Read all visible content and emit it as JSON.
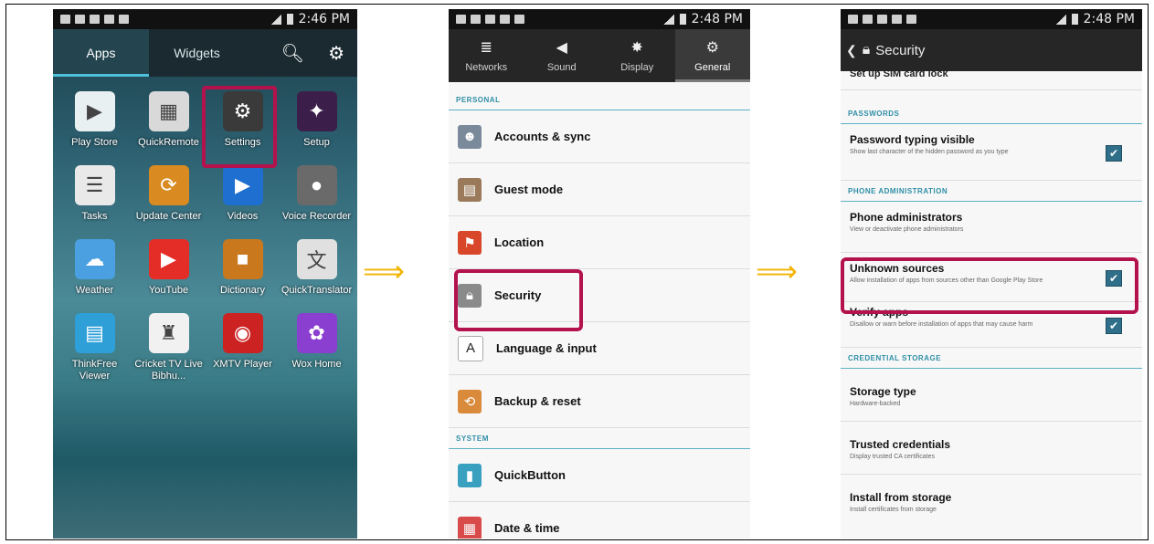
{
  "phone1": {
    "status_time": "2:46 PM",
    "tabs": [
      "Apps",
      "Widgets"
    ],
    "top_icons": [
      "search-icon",
      "gear-icon"
    ],
    "apps": [
      {
        "label": "Play Store",
        "icon": "play-store-icon",
        "color": "#e8f0f2"
      },
      {
        "label": "QuickRemote",
        "icon": "remote-icon",
        "color": "#d9d9d9"
      },
      {
        "label": "Settings",
        "icon": "gear-icon",
        "color": "#3a3a3a"
      },
      {
        "label": "Setup",
        "icon": "magic-hat-icon",
        "color": "#3b1f4a"
      },
      {
        "label": "Tasks",
        "icon": "tasks-icon",
        "color": "#e9e9e9"
      },
      {
        "label": "Update Center",
        "icon": "update-icon",
        "color": "#d98a20"
      },
      {
        "label": "Videos",
        "icon": "video-icon",
        "color": "#1e6fd0"
      },
      {
        "label": "Voice Recorder",
        "icon": "mic-icon",
        "color": "#6a6a6a"
      },
      {
        "label": "Weather",
        "icon": "weather-icon",
        "color": "#4aa0e0"
      },
      {
        "label": "YouTube",
        "icon": "youtube-icon",
        "color": "#e52d27"
      },
      {
        "label": "Dictionary",
        "icon": "book-icon",
        "color": "#c9781e"
      },
      {
        "label": "QuickTranslator",
        "icon": "translate-icon",
        "color": "#e0e0e0"
      },
      {
        "label": "ThinkFree Viewer",
        "icon": "document-icon",
        "color": "#2f9fd8"
      },
      {
        "label": "Cricket TV Live Bibhu...",
        "icon": "cricket-icon",
        "color": "#f1f1f1"
      },
      {
        "label": "XMTV Player",
        "icon": "play-circle-icon",
        "color": "#c22"
      },
      {
        "label": "Wox Home",
        "icon": "wox-icon",
        "color": "#8a3fd0"
      }
    ]
  },
  "phone2": {
    "status_time": "2:48 PM",
    "tabs": [
      {
        "label": "Networks",
        "icon": "wifi-icon"
      },
      {
        "label": "Sound",
        "icon": "speaker-icon"
      },
      {
        "label": "Display",
        "icon": "brightness-icon"
      },
      {
        "label": "General",
        "icon": "gear-icon"
      }
    ],
    "section_personal": "PERSONAL",
    "personal_items": [
      {
        "label": "Accounts & sync",
        "icon": "accounts-icon",
        "color": "#7a8a9a"
      },
      {
        "label": "Guest mode",
        "icon": "guest-icon",
        "color": "#9a7a5a"
      },
      {
        "label": "Location",
        "icon": "location-icon",
        "color": "#d9472b"
      },
      {
        "label": "Security",
        "icon": "lock-icon",
        "color": "#8a8a8a"
      },
      {
        "label": "Language & input",
        "icon": "language-icon",
        "color": "#ffffff"
      },
      {
        "label": "Backup & reset",
        "icon": "backup-icon",
        "color": "#d98a3a"
      }
    ],
    "section_system": "SYSTEM",
    "system_items": [
      {
        "label": "QuickButton",
        "icon": "quickbutton-icon",
        "color": "#3aa0c0"
      },
      {
        "label": "Date & time",
        "icon": "calendar-icon",
        "color": "#d94a4a"
      }
    ]
  },
  "phone3": {
    "status_time": "2:48 PM",
    "header_title": "Security",
    "partial_top": "Set up SIM card lock",
    "section_passwords": "PASSWORDS",
    "password_typing": {
      "title": "Password typing visible",
      "sub": "Show last character of the hidden password as you type"
    },
    "section_admin": "PHONE ADMINISTRATION",
    "phone_admins": {
      "title": "Phone administrators",
      "sub": "View or deactivate phone administrators"
    },
    "unknown_sources": {
      "title": "Unknown sources",
      "sub": "Allow installation of apps from sources other than Google Play Store"
    },
    "verify_apps": {
      "title": "Verify apps",
      "sub": "Disallow or warn before installation of apps that may cause harm"
    },
    "section_credential": "CREDENTIAL STORAGE",
    "storage_type": {
      "title": "Storage type",
      "sub": "Hardware-backed"
    },
    "trusted_credentials": {
      "title": "Trusted credentials",
      "sub": "Display trusted CA certificates"
    },
    "install_storage": {
      "title": "Install from storage",
      "sub": "Install certificates from storage"
    }
  },
  "arrows": [
    "⟹",
    "⟹"
  ],
  "accent_highlight": "#b4124d",
  "arrow_color": "#f2b400"
}
